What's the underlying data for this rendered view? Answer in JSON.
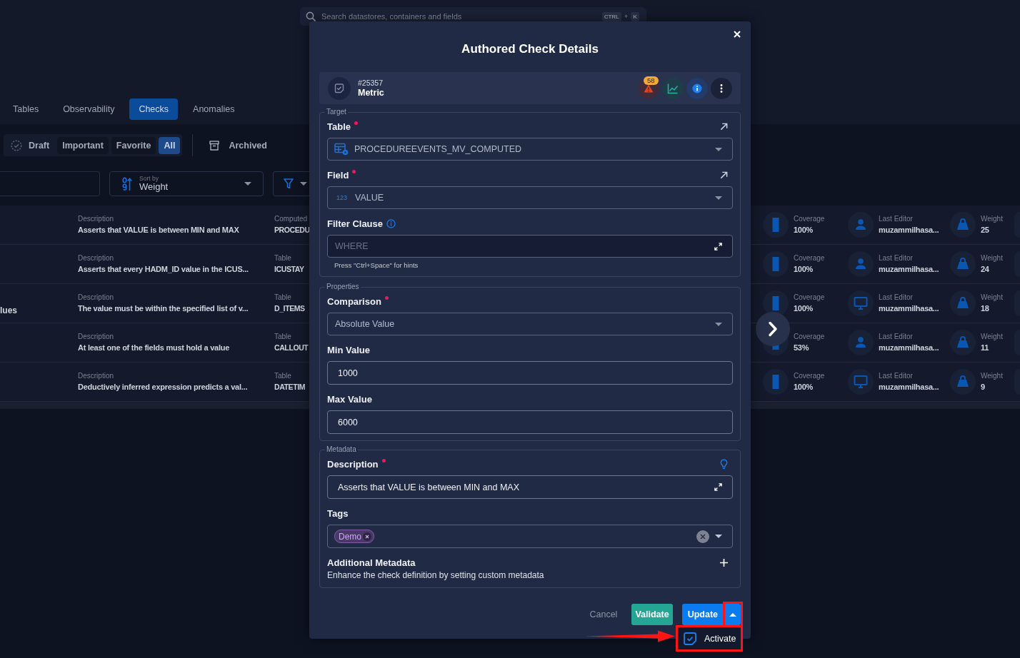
{
  "search_bar": {
    "placeholder": "Search datastores, containers and fields",
    "shortcut_keys": [
      "CTRL",
      "K"
    ],
    "shortcut_joiner": "+"
  },
  "tabs": [
    {
      "label": "Tables",
      "selected": false
    },
    {
      "label": "Observability",
      "selected": false
    },
    {
      "label": "Checks",
      "selected": true
    },
    {
      "label": "Anomalies",
      "selected": false
    }
  ],
  "status_filters": [
    {
      "label": "Draft",
      "kind": "draft",
      "selected": false
    },
    {
      "label": "Important",
      "kind": "plain",
      "selected": false
    },
    {
      "label": "Favorite",
      "kind": "plain",
      "selected": false
    },
    {
      "label": "All",
      "kind": "plain",
      "selected": true
    }
  ],
  "archived": {
    "label": "Archived"
  },
  "sort": {
    "label": "Sort by",
    "value": "Weight"
  },
  "checks": [
    {
      "kind": "user",
      "description_label": "Description",
      "description": "Asserts that VALUE is between MIN and MAX",
      "target_label": "Computed",
      "target": "PROCEDU",
      "coverage_label": "Coverage",
      "coverage": "100%",
      "editor_label": "Last Editor",
      "editor": "muzammilhasa...",
      "weight_label": "Weight",
      "weight": "25"
    },
    {
      "kind": "user",
      "description_label": "Description",
      "description": "Asserts that every HADM_ID value in the ICUS...",
      "target_label": "Table",
      "target": "ICUSTAY",
      "coverage_label": "Coverage",
      "coverage": "100%",
      "editor_label": "Last Editor",
      "editor": "muzammilhasa...",
      "weight_label": "Weight",
      "weight": "24"
    },
    {
      "kind": "system",
      "column_1": "lues",
      "description_label": "Description",
      "description": "The value must be within the specified list of v...",
      "target_label": "Table",
      "target": "D_ITEMS",
      "coverage_label": "Coverage",
      "coverage": "100%",
      "editor_label": "Last Editor",
      "editor": "muzammilhasa...",
      "weight_label": "Weight",
      "weight": "18"
    },
    {
      "kind": "user",
      "description_label": "Description",
      "description": "At least one of the fields must hold a value",
      "target_label": "Table",
      "target": "CALLOUT",
      "coverage_label": "Coverage",
      "coverage": "53%",
      "editor_label": "Last Editor",
      "editor": "muzammilhasa...",
      "weight_label": "Weight",
      "weight": "11"
    },
    {
      "kind": "system",
      "description_label": "Description",
      "description": "Deductively inferred expression predicts a val...",
      "target_label": "Table",
      "target": "DATETIM",
      "coverage_label": "Coverage",
      "coverage": "100%",
      "editor_label": "Last Editor",
      "editor": "muzammilhasa...",
      "weight_label": "Weight",
      "weight": "9"
    }
  ],
  "dialog": {
    "title": "Authored Check Details",
    "check": {
      "id": "#25357",
      "type": "Metric",
      "anomaly_count": "58"
    },
    "sections": [
      {
        "legend": "Target",
        "fields": [
          {
            "kind": "table",
            "label": "Table",
            "required": true,
            "value": "PROCEDUREEVENTS_MV_COMPUTED"
          },
          {
            "kind": "field",
            "label": "Field",
            "required": true,
            "type_label": "123",
            "value": "VALUE"
          },
          {
            "kind": "filter",
            "label": "Filter Clause",
            "required": false,
            "placeholder": "WHERE",
            "hint": "Press \"Ctrl+Space\" for hints"
          }
        ]
      },
      {
        "legend": "Properties",
        "fields": [
          {
            "kind": "select",
            "label": "Comparison",
            "required": true,
            "value": "Absolute Value"
          },
          {
            "kind": "text",
            "label": "Min Value",
            "required": false,
            "value": "1000"
          },
          {
            "kind": "text",
            "label": "Max Value",
            "required": false,
            "value": "6000"
          }
        ]
      },
      {
        "legend": "Metadata",
        "fields": [
          {
            "kind": "description",
            "label": "Description",
            "required": true,
            "value": "Asserts that VALUE is between MIN and MAX"
          },
          {
            "kind": "tags",
            "label": "Tags",
            "required": false,
            "tags": [
              "Demo"
            ]
          },
          {
            "kind": "extra",
            "label": "Additional Metadata",
            "required": false,
            "text": "Enhance the check definition by setting custom metadata"
          }
        ]
      }
    ],
    "buttons": [
      {
        "label": "Cancel",
        "kind": "cancel"
      },
      {
        "label": "Validate",
        "kind": "validate"
      },
      {
        "label": "Update",
        "kind": "primary"
      }
    ],
    "split_menu": {
      "expanded": true,
      "highlighted": true,
      "items": [
        {
          "label": "Activate",
          "highlighted": true
        }
      ]
    }
  }
}
